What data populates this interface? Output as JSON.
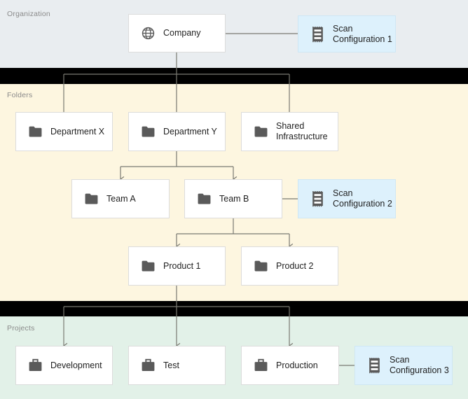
{
  "diagram": {
    "title": "Organization / Folders / Projects hierarchy",
    "type": "hierarchy-tree",
    "colors": {
      "organization_band": "#e9edf0",
      "folders_band": "#fdf6e0",
      "projects_band": "#e2f1e8",
      "separator": "#000000",
      "node_fill": "#ffffff",
      "node_border": "#dcdcdc",
      "scan_fill": "#ddf1fc",
      "scan_border": "#cfe7f4",
      "connector": "#7a7a72",
      "icon": "#5a5a5a",
      "band_label_text": "#8a8a8a",
      "node_label_text": "#1f1f1f"
    }
  },
  "bands": [
    {
      "id": "organization",
      "label": "Organization"
    },
    {
      "id": "folders",
      "label": "Folders"
    },
    {
      "id": "projects",
      "label": "Projects"
    }
  ],
  "nodes": {
    "company": {
      "label": "Company",
      "icon": "globe-icon",
      "kind": "organization"
    },
    "scan_config_1": {
      "label": "Scan\nConfiguration 1",
      "icon": "scan-doc-icon",
      "kind": "scan-configuration"
    },
    "department_x": {
      "label": "Department X",
      "icon": "folder-icon",
      "kind": "folder"
    },
    "department_y": {
      "label": "Department Y",
      "icon": "folder-icon",
      "kind": "folder"
    },
    "shared_infra": {
      "label": "Shared\nInfrastructure",
      "icon": "folder-icon",
      "kind": "folder"
    },
    "team_a": {
      "label": "Team A",
      "icon": "folder-icon",
      "kind": "folder"
    },
    "team_b": {
      "label": "Team B",
      "icon": "folder-icon",
      "kind": "folder"
    },
    "scan_config_2": {
      "label": "Scan\nConfiguration 2",
      "icon": "scan-doc-icon",
      "kind": "scan-configuration"
    },
    "product_1": {
      "label": "Product 1",
      "icon": "folder-icon",
      "kind": "folder"
    },
    "product_2": {
      "label": "Product 2",
      "icon": "folder-icon",
      "kind": "folder"
    },
    "development": {
      "label": "Development",
      "icon": "briefcase-icon",
      "kind": "project"
    },
    "test": {
      "label": "Test",
      "icon": "briefcase-icon",
      "kind": "project"
    },
    "production": {
      "label": "Production",
      "icon": "briefcase-icon",
      "kind": "project"
    },
    "scan_config_3": {
      "label": "Scan\nConfiguration 3",
      "icon": "scan-doc-icon",
      "kind": "scan-configuration"
    }
  },
  "edges": [
    {
      "from": "company",
      "to": "scan_config_1",
      "style": "plain"
    },
    {
      "from": "company",
      "to": "department_x",
      "style": "arrow"
    },
    {
      "from": "company",
      "to": "department_y",
      "style": "arrow"
    },
    {
      "from": "company",
      "to": "shared_infra",
      "style": "arrow"
    },
    {
      "from": "department_y",
      "to": "team_a",
      "style": "arrow"
    },
    {
      "from": "department_y",
      "to": "team_b",
      "style": "arrow"
    },
    {
      "from": "team_b",
      "to": "scan_config_2",
      "style": "plain"
    },
    {
      "from": "team_b",
      "to": "product_1",
      "style": "arrow"
    },
    {
      "from": "team_b",
      "to": "product_2",
      "style": "arrow"
    },
    {
      "from": "product_1",
      "to": "development",
      "style": "arrow"
    },
    {
      "from": "product_1",
      "to": "test",
      "style": "arrow"
    },
    {
      "from": "product_1",
      "to": "production",
      "style": "arrow"
    },
    {
      "from": "production",
      "to": "scan_config_3",
      "style": "plain"
    }
  ]
}
